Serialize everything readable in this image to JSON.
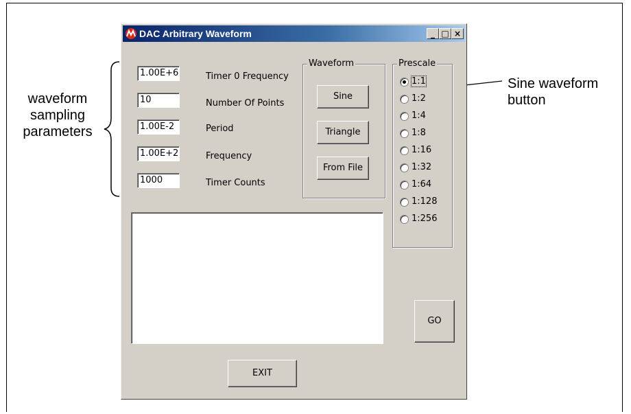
{
  "window": {
    "title": "DAC Arbitrary Waveform",
    "controls": {
      "minimize": "_",
      "maximize": "□",
      "close": "×"
    }
  },
  "fields": [
    {
      "value": "1.00E+6",
      "label": "Timer 0 Frequency"
    },
    {
      "value": "10",
      "label": "Number Of Points"
    },
    {
      "value": "1.00E-2",
      "label": "Period"
    },
    {
      "value": "1.00E+2",
      "label": "Frequency"
    },
    {
      "value": "1000",
      "label": "Timer Counts"
    }
  ],
  "waveform_group": {
    "label": "Waveform",
    "buttons": [
      "Sine",
      "Triangle",
      "From File"
    ]
  },
  "prescale_group": {
    "label": "Prescale",
    "options": [
      "1:1",
      "1:2",
      "1:4",
      "1:8",
      "1:16",
      "1:32",
      "1:64",
      "1:128",
      "1:256"
    ],
    "selected": "1:1"
  },
  "go_label": "GO",
  "exit_label": "EXIT",
  "annotations": {
    "left_line1": "waveform",
    "left_line2": "sampling",
    "left_line3": "parameters",
    "right_line1": "Sine waveform",
    "right_line2": "button"
  }
}
